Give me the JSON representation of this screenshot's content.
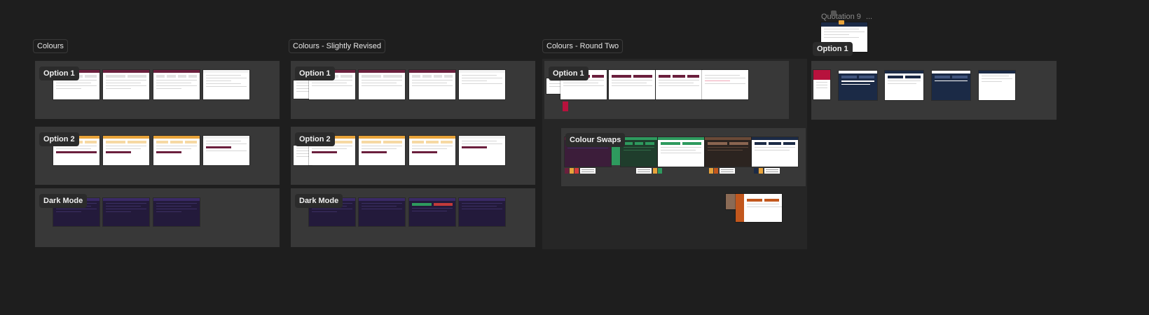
{
  "canvas": {
    "frames": [
      {
        "title": "Colours"
      },
      {
        "title": "Colours - Slightly Revised"
      },
      {
        "title": "Colours - Round Two"
      }
    ],
    "labels": {
      "option1": "Option 1",
      "option2": "Option 2",
      "dark_mode": "Dark Mode",
      "colour_swaps": "Colour Swaps"
    },
    "quotation": {
      "title": "Quotation 9",
      "ellipsis": "..."
    }
  },
  "colors": {
    "canvas_bg": "#1e1e1e",
    "section_bg": "#383838",
    "maroon": "#6b1f3d",
    "gold": "#e8a33a",
    "purple_dark": "#231a3b",
    "green": "#2e9a5e",
    "brown": "#6b4a37",
    "navy": "#1b2a46",
    "orange": "#c2571d"
  }
}
